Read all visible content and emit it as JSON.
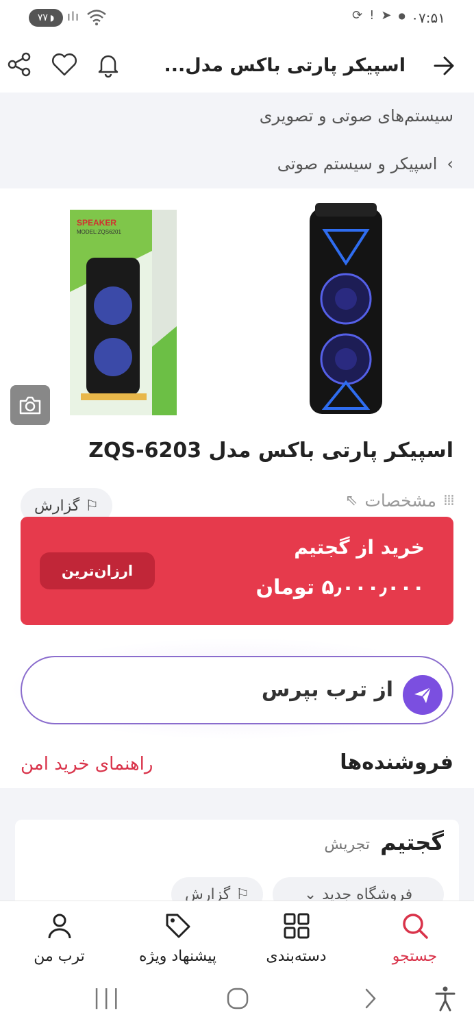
{
  "status_bar": {
    "time": "۰۷:۵۱",
    "battery": "۷۷"
  },
  "app_bar": {
    "title": "اسپیکر پارتی باکس مدل..."
  },
  "breadcrumb": {
    "level1": "سیستم‌های صوتی و تصویری",
    "level2": "اسپیکر و سیستم صوتی",
    "separator": "›"
  },
  "product": {
    "title": "اسپیکر پارتی باکس مدل ZQS-6203",
    "box_brand": "SPEAKER",
    "box_model": "MODEL:ZQS6201"
  },
  "specs": {
    "label": "مشخصات",
    "report_label": "گزارش"
  },
  "buy_card": {
    "label": "خرید از گجتیم",
    "price": "۵٫۰۰۰٫۰۰۰ تومان",
    "badge": "ارزان‌ترین"
  },
  "ask": {
    "label": "از ترب بپرس"
  },
  "sellers": {
    "title": "فروشنده‌ها",
    "safe_guide": "راهنمای خرید امن",
    "card": {
      "name": "گجتیم",
      "city": "تجریش",
      "status_chip": "فروشگاه جدید",
      "report_chip": "گزارش"
    }
  },
  "bottom_nav": {
    "items": [
      {
        "label": "جستجو",
        "icon": "search-icon",
        "active": true
      },
      {
        "label": "دسته‌بندی",
        "icon": "grid-icon",
        "active": false
      },
      {
        "label": "پیشنهاد ویژه",
        "icon": "tag-icon",
        "active": false
      },
      {
        "label": "ترب من",
        "icon": "user-icon",
        "active": false
      }
    ]
  },
  "colors": {
    "accent_red": "#e63a4c",
    "ask_purple": "#7b4fe0",
    "breadcrumb_bg": "#f3f4f8"
  }
}
